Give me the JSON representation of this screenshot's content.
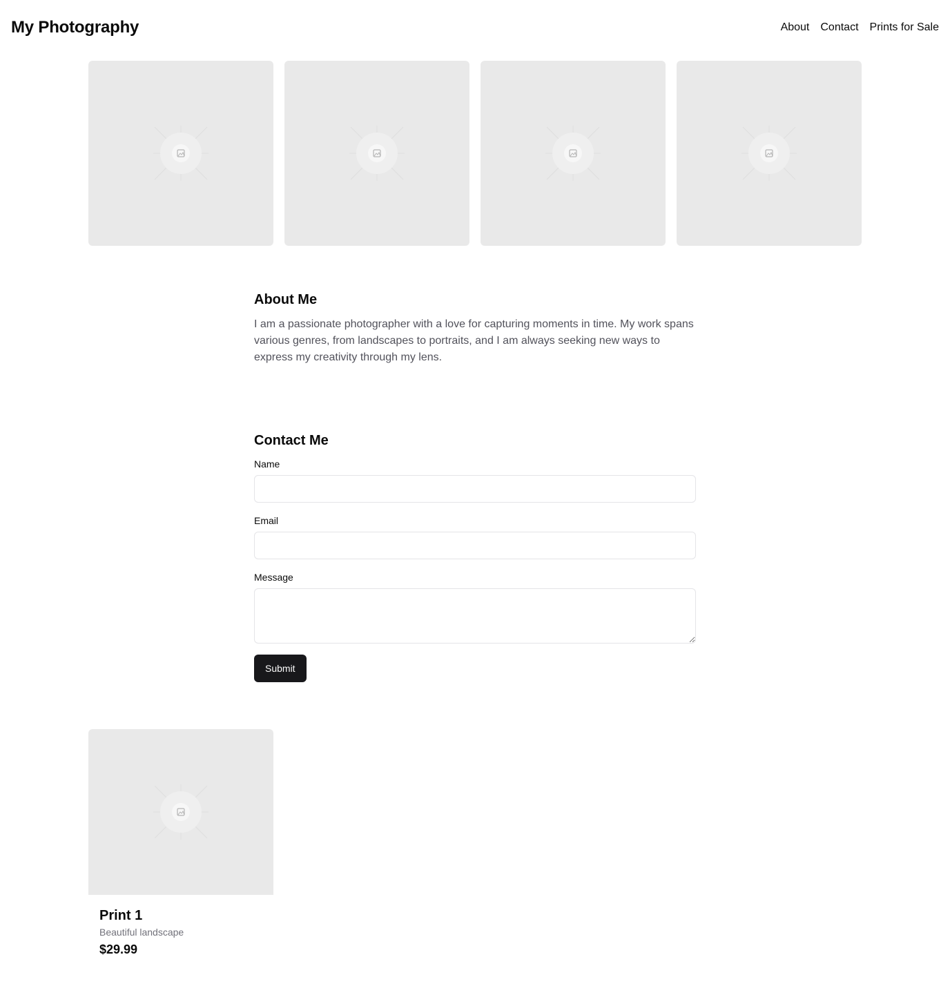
{
  "header": {
    "title": "My Photography",
    "nav": [
      {
        "label": "About"
      },
      {
        "label": "Contact"
      },
      {
        "label": "Prints for Sale"
      }
    ]
  },
  "gallery": {
    "items": [
      {
        "icon": "image-placeholder-icon"
      },
      {
        "icon": "image-placeholder-icon"
      },
      {
        "icon": "image-placeholder-icon"
      },
      {
        "icon": "image-placeholder-icon"
      }
    ]
  },
  "about": {
    "title": "About Me",
    "text": "I am a passionate photographer with a love for capturing moments in time. My work spans various genres, from landscapes to portraits, and I am always seeking new ways to express my creativity through my lens."
  },
  "contact": {
    "title": "Contact Me",
    "name_label": "Name",
    "name_value": "",
    "email_label": "Email",
    "email_value": "",
    "message_label": "Message",
    "message_value": "",
    "submit_label": "Submit"
  },
  "prints": {
    "items": [
      {
        "title": "Print 1",
        "description": "Beautiful landscape",
        "price": "$29.99",
        "icon": "image-placeholder-icon"
      }
    ]
  },
  "colors": {
    "placeholder_bg": "#e9e9e9",
    "button_bg": "#18181b",
    "muted_text": "#52525b"
  }
}
